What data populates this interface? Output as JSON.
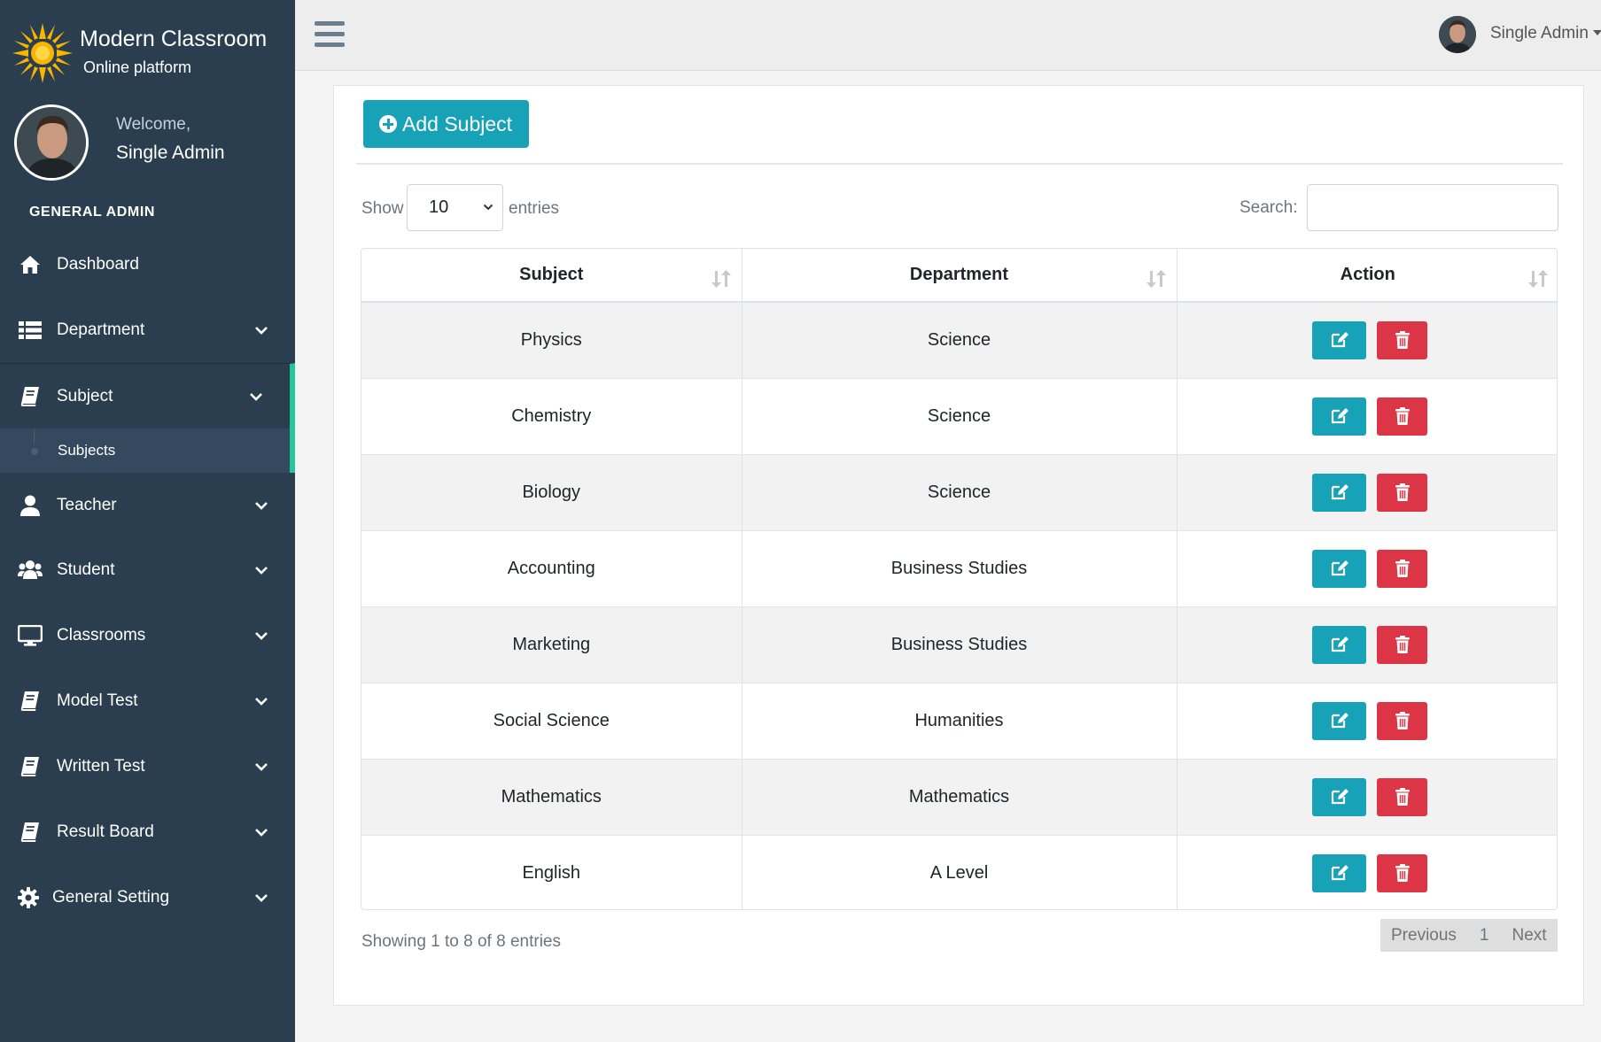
{
  "brand": {
    "name": "Modern Classroom",
    "tagline": "Online platform"
  },
  "user": {
    "welcome": "Welcome,",
    "name": "Single Admin",
    "role": "GENERAL ADMIN"
  },
  "topbar": {
    "user_name": "Single Admin"
  },
  "nav": {
    "dashboard": "Dashboard",
    "department": "Department",
    "subject": "Subject",
    "subjects": "Subjects",
    "teacher": "Teacher",
    "student": "Student",
    "classrooms": "Classrooms",
    "model_test": "Model Test",
    "written_test": "Written Test",
    "result_board": "Result Board",
    "general_setting": "General Setting"
  },
  "toolbar": {
    "add_label": "Add Subject"
  },
  "table_controls": {
    "show": "Show",
    "length": "10",
    "entries": "entries",
    "search_label": "Search:",
    "search_value": ""
  },
  "table": {
    "columns": [
      "Subject",
      "Department",
      "Action"
    ],
    "rows": [
      {
        "subject": "Physics",
        "department": "Science"
      },
      {
        "subject": "Chemistry",
        "department": "Science"
      },
      {
        "subject": "Biology",
        "department": "Science"
      },
      {
        "subject": "Accounting",
        "department": "Business Studies"
      },
      {
        "subject": "Marketing",
        "department": "Business Studies"
      },
      {
        "subject": "Social Science",
        "department": "Humanities"
      },
      {
        "subject": "Mathematics",
        "department": "Mathematics"
      },
      {
        "subject": "English",
        "department": "A Level"
      }
    ]
  },
  "footer": {
    "info": "Showing 1 to 8 of 8 entries",
    "previous": "Previous",
    "page": "1",
    "next": "Next"
  },
  "colors": {
    "sidebar": "#2b3e50",
    "accent": "#17a2b8",
    "danger": "#dc3545",
    "active_border": "#20c997",
    "logo": "#f7b500"
  }
}
